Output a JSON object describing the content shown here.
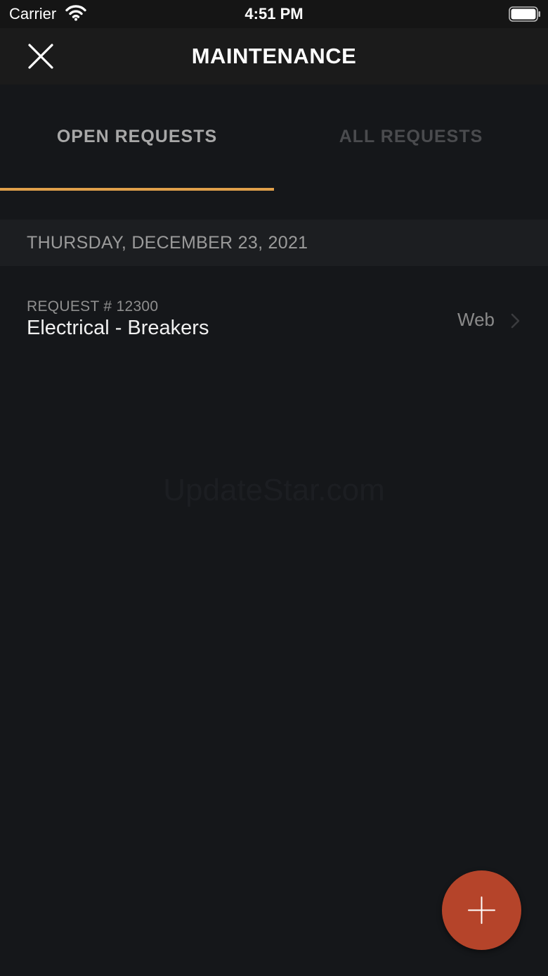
{
  "status_bar": {
    "carrier": "Carrier",
    "time": "4:51 PM",
    "wifi_icon": "wifi-icon",
    "battery_icon": "battery-icon"
  },
  "nav": {
    "title": "MAINTENANCE",
    "close_icon": "close-icon"
  },
  "tabs": [
    {
      "label": "OPEN REQUESTS",
      "selected": true
    },
    {
      "label": "ALL REQUESTS",
      "selected": false
    }
  ],
  "colors": {
    "accent": "#e0a04a",
    "fab": "#b5442a",
    "background": "#15171a"
  },
  "sections": [
    {
      "date": "THURSDAY, DECEMBER 23, 2021",
      "requests": [
        {
          "number": "REQUEST # 12300",
          "title": "Electrical - Breakers",
          "source": "Web",
          "chevron_icon": "chevron-right-icon"
        }
      ]
    }
  ],
  "watermark": "UpdateStar.com",
  "fab": {
    "icon": "plus-icon"
  }
}
